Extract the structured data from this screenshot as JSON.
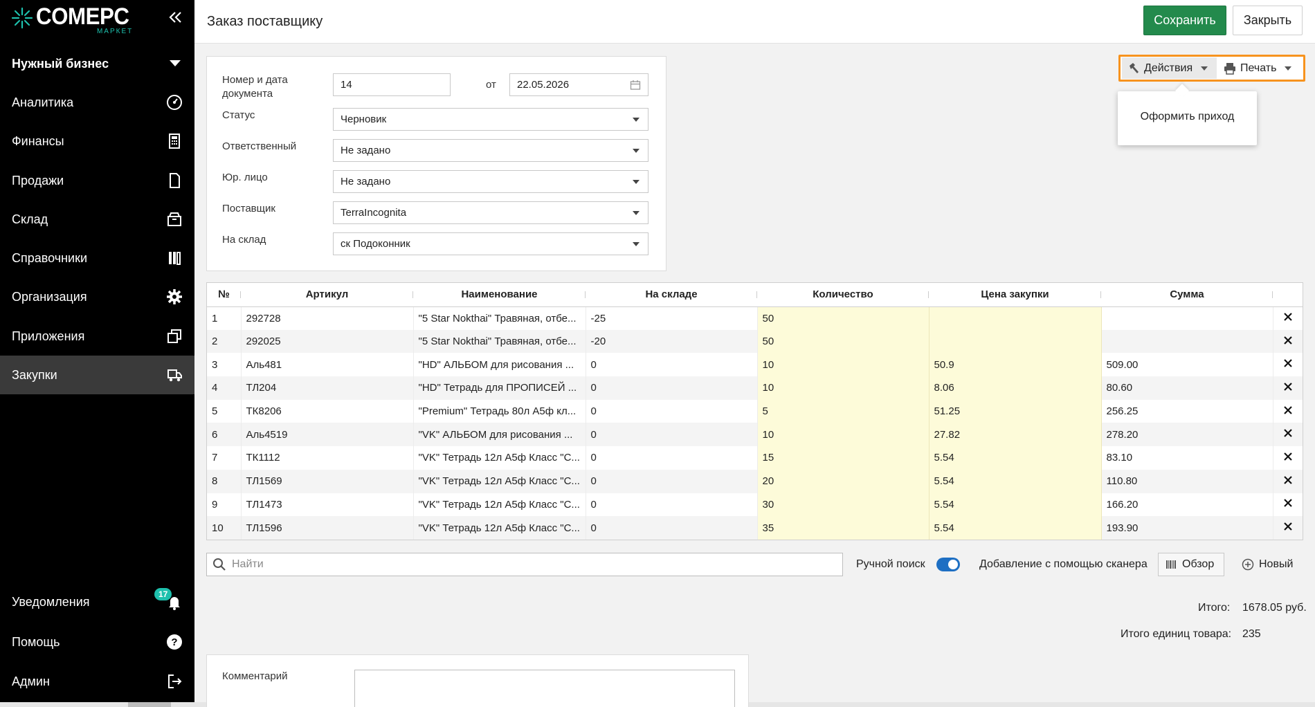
{
  "brand": {
    "title": "COMEPC",
    "subtitle": "МАРКЕТ",
    "accent": "#1ec0ad"
  },
  "sidebar": {
    "business": "Нужный бизнес",
    "items": [
      {
        "label": "Аналитика",
        "icon": "gauge-icon"
      },
      {
        "label": "Финансы",
        "icon": "calculator-icon"
      },
      {
        "label": "Продажи",
        "icon": "document-icon"
      },
      {
        "label": "Склад",
        "icon": "box-icon"
      },
      {
        "label": "Справочники",
        "icon": "books-icon"
      },
      {
        "label": "Организация",
        "icon": "gear-icon"
      },
      {
        "label": "Приложения",
        "icon": "windows-icon"
      },
      {
        "label": "Закупки",
        "icon": "truck-icon",
        "active": true
      }
    ],
    "bottom": [
      {
        "label": "Уведомления",
        "icon": "bell-icon",
        "badge": "17"
      },
      {
        "label": "Помощь",
        "icon": "help-icon"
      },
      {
        "label": "Админ",
        "icon": "logout-icon"
      }
    ]
  },
  "header": {
    "title": "Заказ поставщику",
    "save": "Сохранить",
    "close": "Закрыть"
  },
  "actions": {
    "actions_label": "Действия",
    "print_label": "Печать",
    "menu_item": "Оформить приход"
  },
  "form": {
    "doc_label": "Номер и дата документа",
    "doc_number": "14",
    "from_label": "от",
    "doc_date": "22.05.2026",
    "status_label": "Статус",
    "status": "Черновик",
    "responsible_label": "Ответственный",
    "responsible": "Не задано",
    "legal_label": "Юр. лицо",
    "legal": "Не задано",
    "supplier_label": "Поставщик",
    "supplier": "TerraIncognita",
    "warehouse_label": "На склад",
    "warehouse": "ск Подоконник"
  },
  "table": {
    "headers": [
      "№",
      "Артикул",
      "Наименование",
      "На складе",
      "Количество",
      "Цена закупки",
      "Сумма"
    ],
    "rows": [
      [
        "1",
        "292728",
        "\"5 Star Nokthai\" Травяная, отбе...",
        "-25",
        "50",
        "",
        ""
      ],
      [
        "2",
        "292025",
        "\"5 Star Nokthai\" Травяная, отбе...",
        "-20",
        "50",
        "",
        ""
      ],
      [
        "3",
        "Аль481",
        "\"HD\" АЛЬБОМ для рисования ...",
        "0",
        "10",
        "50.9",
        "509.00"
      ],
      [
        "4",
        "ТЛ204",
        "\"HD\" Тетрадь для ПРОПИСЕЙ ...",
        "0",
        "10",
        "8.06",
        "80.60"
      ],
      [
        "5",
        "ТК8206",
        "\"Premium\" Тетрадь 80л А5ф кл...",
        "0",
        "5",
        "51.25",
        "256.25"
      ],
      [
        "6",
        "Аль4519",
        "\"VK\" АЛЬБОМ для рисования ...",
        "0",
        "10",
        "27.82",
        "278.20"
      ],
      [
        "7",
        "ТК1112",
        "\"VK\" Тетрадь 12л А5ф Класс \"С...",
        "0",
        "15",
        "5.54",
        "83.10"
      ],
      [
        "8",
        "ТЛ1569",
        "\"VK\" Тетрадь 12л А5ф Класс \"С...",
        "0",
        "20",
        "5.54",
        "110.80"
      ],
      [
        "9",
        "ТЛ1473",
        "\"VK\" Тетрадь 12л А5ф Класс \"С...",
        "0",
        "30",
        "5.54",
        "166.20"
      ],
      [
        "10",
        "ТЛ1596",
        "\"VK\" Тетрадь 12л А5ф Класс \"С...",
        "0",
        "35",
        "5.54",
        "193.90"
      ]
    ]
  },
  "search": {
    "placeholder": "Найти",
    "manual_label": "Ручной поиск",
    "manual_on": true,
    "scanner_label": "Добавление с помощью сканера",
    "browse_label": "Обзор",
    "new_label": "Новый"
  },
  "totals": {
    "total_label": "Итого:",
    "total_value": "1678.05 руб.",
    "units_label": "Итого единиц товара:",
    "units_value": "235"
  },
  "comment": {
    "label": "Комментарий"
  }
}
